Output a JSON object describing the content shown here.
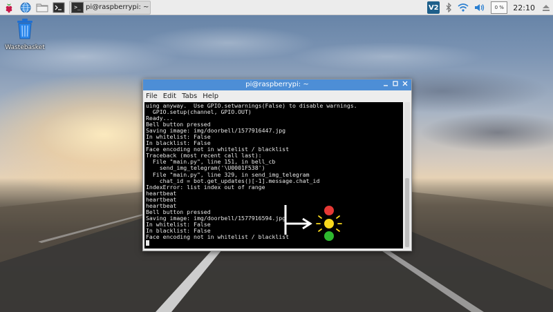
{
  "panel": {
    "launcher_icons": [
      "raspberry-menu-icon",
      "web-browser-globe-icon",
      "file-manager-folder-icon",
      "terminal-icon"
    ],
    "task_button_label": "pi@raspberrypi: ~",
    "cpu_label": "0 %",
    "clock": "22:10",
    "tray_icons": [
      "vnc-icon",
      "bluetooth-icon",
      "wifi-icon",
      "volume-icon",
      "eject-icon"
    ],
    "vnc_label": "V2"
  },
  "desktop": {
    "icons": [
      {
        "name": "wastebasket-icon",
        "label": "Wastebasket"
      }
    ]
  },
  "window": {
    "title": "pi@raspberrypi: ~",
    "menu": [
      "File",
      "Edit",
      "Tabs",
      "Help"
    ],
    "terminal_lines": [
      "uing anyway.  Use GPIO.setwarnings(False) to disable warnings.",
      "  GPIO.setup(channel, GPIO.OUT)",
      "Ready...",
      "Bell button pressed",
      "Saving image: img/doorbell/1577916447.jpg",
      "In whitelist: False",
      "In blacklist: False",
      "Face encoding not in whitelist / blacklist",
      "Traceback (most recent call last):",
      "  File \"main.py\", line 151, in bell_cb",
      "    send_img_telegram('\\U0001F538')",
      "  File \"main.py\", line 329, in send_img_telegram",
      "    chat_id = bot.get_updates()[-1].message.chat_id",
      "IndexError: list index out of range",
      "heartbeat",
      "heartbeat",
      "heartbeat",
      "Bell button pressed",
      "Saving image: img/doorbell/1577916594.jpg",
      "In whitelist: False",
      "In blacklist: False",
      "Face encoding not in whitelist / blacklist"
    ]
  },
  "annotation": {
    "traffic_light_colors": [
      "#e53935",
      "#f7d71c",
      "#2eb82e"
    ],
    "active_light": "yellow",
    "arrow_color": "#ffffff"
  }
}
